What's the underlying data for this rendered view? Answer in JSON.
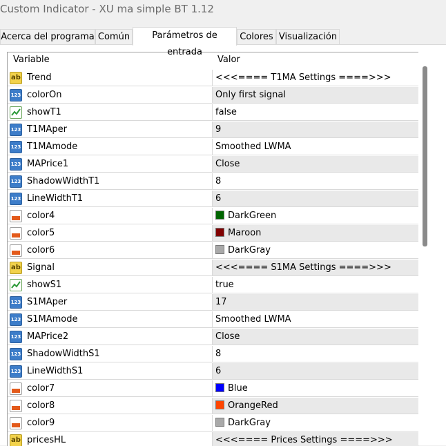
{
  "window": {
    "title": "Custom Indicator - XU ma simple BT 1.12"
  },
  "tabs": [
    {
      "label": "Acerca del programa"
    },
    {
      "label": "Común"
    },
    {
      "label": "Parámetros de entrada"
    },
    {
      "label": "Colores"
    },
    {
      "label": "Visualización"
    }
  ],
  "active_tab": "Parámetros de entrada",
  "grid": {
    "headers": {
      "variable": "Variable",
      "value": "Valor"
    },
    "rows": [
      {
        "icon": "string-icon",
        "variable": "Trend",
        "value": "<<<==== T1MA Settings ====>>>"
      },
      {
        "icon": "integer-icon",
        "variable": "colorOn",
        "value": "Only first signal"
      },
      {
        "icon": "bool-icon",
        "variable": "showT1",
        "value": "false"
      },
      {
        "icon": "integer-icon",
        "variable": "T1MAper",
        "value": "9"
      },
      {
        "icon": "integer-icon",
        "variable": "T1MAmode",
        "value": "Smoothed LWMA"
      },
      {
        "icon": "integer-icon",
        "variable": "MAPrice1",
        "value": "Close"
      },
      {
        "icon": "integer-icon",
        "variable": "ShadowWidthT1",
        "value": "8"
      },
      {
        "icon": "integer-icon",
        "variable": "LineWidthT1",
        "value": "6"
      },
      {
        "icon": "color-icon",
        "variable": "color4",
        "value": "DarkGreen",
        "swatch": "#006400"
      },
      {
        "icon": "color-icon",
        "variable": "color5",
        "value": "Maroon",
        "swatch": "#800000"
      },
      {
        "icon": "color-icon",
        "variable": "color6",
        "value": "DarkGray",
        "swatch": "#a9a9a9"
      },
      {
        "icon": "string-icon",
        "variable": "Signal",
        "value": "<<<==== S1MA Settings ====>>>"
      },
      {
        "icon": "bool-icon",
        "variable": "showS1",
        "value": "true"
      },
      {
        "icon": "integer-icon",
        "variable": "S1MAper",
        "value": "17"
      },
      {
        "icon": "integer-icon",
        "variable": "S1MAmode",
        "value": "Smoothed LWMA"
      },
      {
        "icon": "integer-icon",
        "variable": "MAPrice2",
        "value": "Close"
      },
      {
        "icon": "integer-icon",
        "variable": "ShadowWidthS1",
        "value": "8"
      },
      {
        "icon": "integer-icon",
        "variable": "LineWidthS1",
        "value": "6"
      },
      {
        "icon": "color-icon",
        "variable": "color7",
        "value": "Blue",
        "swatch": "#0000ff"
      },
      {
        "icon": "color-icon",
        "variable": "color8",
        "value": "OrangeRed",
        "swatch": "#ff4500"
      },
      {
        "icon": "color-icon",
        "variable": "color9",
        "value": "DarkGray",
        "swatch": "#a9a9a9"
      },
      {
        "icon": "string-icon",
        "variable": "pricesHL",
        "value": "<<<==== Prices Settings ====>>>"
      }
    ]
  }
}
